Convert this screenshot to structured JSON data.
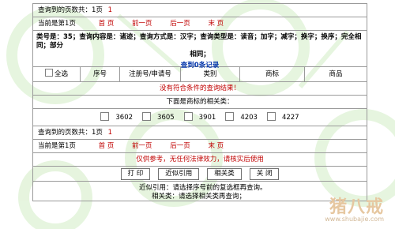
{
  "pager_top": {
    "total_text": "查询到的页数共：1页",
    "page_num": "1",
    "current_text": "当前是第1页",
    "links": [
      "首 页",
      "前一页",
      "后一页",
      "末 页"
    ]
  },
  "query": {
    "summary_line1": "类号是：35；查询内容是：诸迹；查询方式是：汉字；查询类型是：读音；加字；减字；换字；换序；完全相同；部分",
    "summary_line2": "相同；",
    "result_count": "查到0条记录"
  },
  "table": {
    "select_all_label": "全选",
    "columns": [
      "序号",
      "注册号/申请号",
      "类别",
      "商标",
      "商品"
    ]
  },
  "no_result_text": "没有符合条件的查询结果！",
  "related": {
    "title": "下面是商标的相关类：",
    "codes": [
      "3602",
      "3605",
      "3901",
      "4203",
      "4227"
    ]
  },
  "pager_bottom": {
    "total_text": "查询到的页数共：1页",
    "page_num": "1",
    "current_text": "当前是第1页",
    "links": [
      "首 页",
      "前一页",
      "后一页",
      "末 页"
    ]
  },
  "disclaimer": "仅供参考，无任何法律效力，请核实后使用",
  "buttons": {
    "print": "打 印",
    "similar": "近似引用",
    "related": "相关类",
    "close": "关 闭"
  },
  "footer": {
    "line1": "近似引用：请选择序号前的复选框再查询。",
    "line2": "相关类：请选择相关类再查询；"
  },
  "watermark": {
    "text": "猪八戒",
    "url": "www.shubajie.com"
  },
  "colors": {
    "accent_red": "#c00000",
    "link_blue": "#0033aa",
    "border_gray": "#9a9a9a",
    "watermark_green": "#7ecb63"
  }
}
